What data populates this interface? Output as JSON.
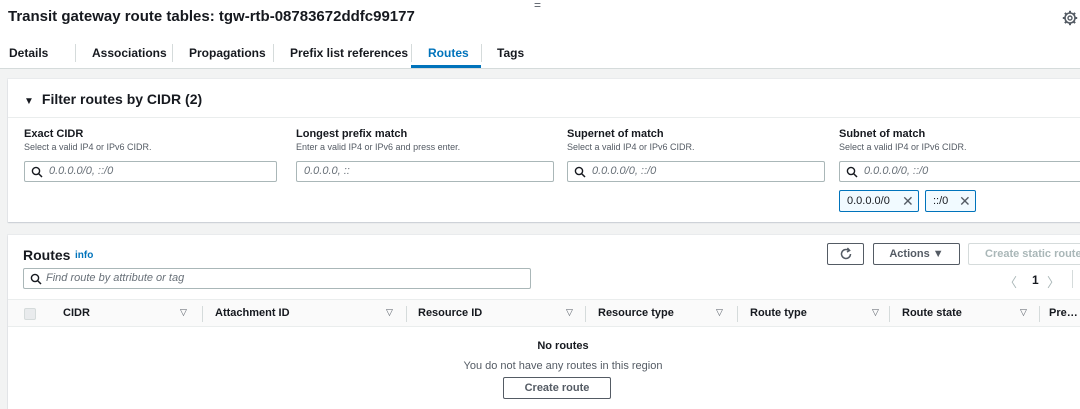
{
  "header": {
    "title": "Transit gateway route tables: tgw-rtb-08783672ddfc99177",
    "drag_handle": "=",
    "settings_icon": "gear-icon"
  },
  "tabs": [
    {
      "label": "Details"
    },
    {
      "label": "Associations"
    },
    {
      "label": "Propagations"
    },
    {
      "label": "Prefix list references"
    },
    {
      "label": "Routes",
      "active": true
    },
    {
      "label": "Tags"
    }
  ],
  "filter": {
    "title": "Filter routes by CIDR (2)",
    "columns": [
      {
        "label": "Exact CIDR",
        "description": "Select a valid IP4 or IPv6 CIDR.",
        "placeholder": "0.0.0.0/0, ::/0",
        "icon": "search-icon"
      },
      {
        "label": "Longest prefix match",
        "description": "Enter a valid IP4 or IPv6 and press enter.",
        "placeholder": "0.0.0.0, ::"
      },
      {
        "label": "Supernet of match",
        "description": "Select a valid IP4 or IPv6 CIDR.",
        "placeholder": "0.0.0.0/0, ::/0",
        "icon": "search-icon"
      },
      {
        "label": "Subnet of match",
        "description": "Select a valid IP4 or IPv6 CIDR.",
        "placeholder": "0.0.0.0/0, ::/0",
        "icon": "search-icon"
      }
    ],
    "tokens": [
      {
        "label": "0.0.0.0/0",
        "remove": "✕"
      },
      {
        "label": "::/0",
        "remove": "✕"
      }
    ]
  },
  "routes": {
    "title": "Routes",
    "info": "info",
    "refresh_icon": "refresh-icon",
    "actions_label": "Actions ▼",
    "create_static_label": "Create static route",
    "search_placeholder": "Find route by attribute or tag",
    "pager": {
      "prev": "〈",
      "page": "1",
      "next": "〉"
    },
    "columns": [
      "CIDR",
      "Attachment ID",
      "Resource ID",
      "Resource type",
      "Route type",
      "Route state",
      "Pre…"
    ],
    "sort_glyph": "▽",
    "empty_title": "No routes",
    "empty_description": "You do not have any routes in this region",
    "create_route_label": "Create route"
  },
  "colors": {
    "accent": "#0073bb",
    "text": "#16191f",
    "muted": "#545b64",
    "background": "#f2f3f3"
  }
}
